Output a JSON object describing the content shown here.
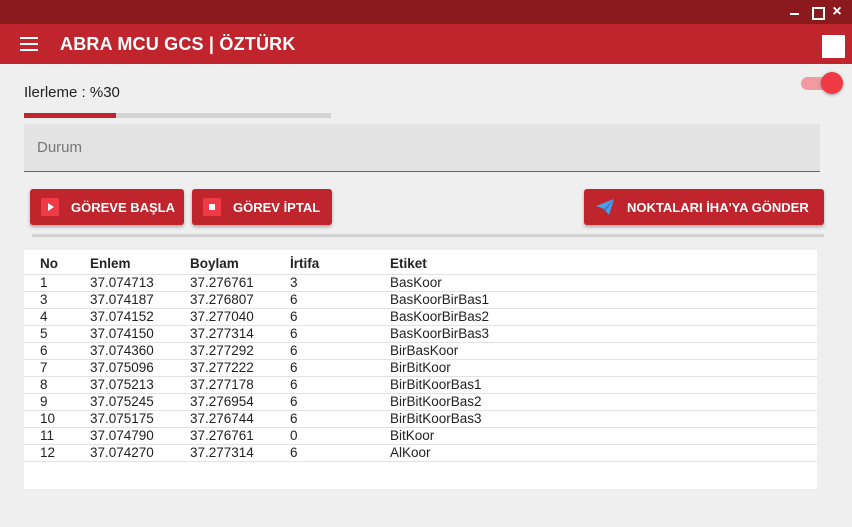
{
  "window": {
    "controls": [
      "minimize-icon",
      "maximize-icon",
      "close-icon"
    ],
    "close_glyph": "×"
  },
  "app": {
    "title": "ABRA MCU GCS | ÖZTÜRK",
    "menu_icon": "hamburger-menu-icon"
  },
  "progress": {
    "label": "Ilerleme : %30",
    "value_percent": 30
  },
  "toggle": {
    "state": "on"
  },
  "status": {
    "placeholder": "Durum"
  },
  "buttons": {
    "start": {
      "label": "GÖREVE BAŞLA",
      "icon": "play-icon"
    },
    "cancel": {
      "label": "GÖREV İPTAL",
      "icon": "stop-icon"
    },
    "send": {
      "label": "NOKTALARI İHA'YA GÖNDER",
      "icon": "send-icon"
    }
  },
  "table": {
    "headers": [
      "No",
      "Enlem",
      "Boylam",
      "İrtifa",
      "Etiket"
    ],
    "rows": [
      [
        "1",
        "37.074713",
        "37.276761",
        "3",
        "BasKoor"
      ],
      [
        "3",
        "37.074187",
        "37.276807",
        "6",
        "BasKoorBirBas1"
      ],
      [
        "4",
        "37.074152",
        "37.277040",
        "6",
        "BasKoorBirBas2"
      ],
      [
        "5",
        "37.074150",
        "37.277314",
        "6",
        "BasKoorBirBas3"
      ],
      [
        "6",
        "37.074360",
        "37.277292",
        "6",
        "BirBasKoor"
      ],
      [
        "7",
        "37.075096",
        "37.277222",
        "6",
        "BirBitKoor"
      ],
      [
        "8",
        "37.075213",
        "37.277178",
        "6",
        "BirBitKoorBas1"
      ],
      [
        "9",
        "37.075245",
        "37.276954",
        "6",
        "BirBitKoorBas2"
      ],
      [
        "10",
        "37.075175",
        "37.276744",
        "6",
        "BirBitKoorBas3"
      ],
      [
        "11",
        "37.074790",
        "37.276761",
        "0",
        "BitKoor"
      ],
      [
        "12",
        "37.074270",
        "37.277314",
        "6",
        "AlKoor"
      ]
    ]
  },
  "colors": {
    "titlebar": "#8b1a1f",
    "accent": "#c0242c",
    "toggle_knob": "#ee3a45"
  }
}
